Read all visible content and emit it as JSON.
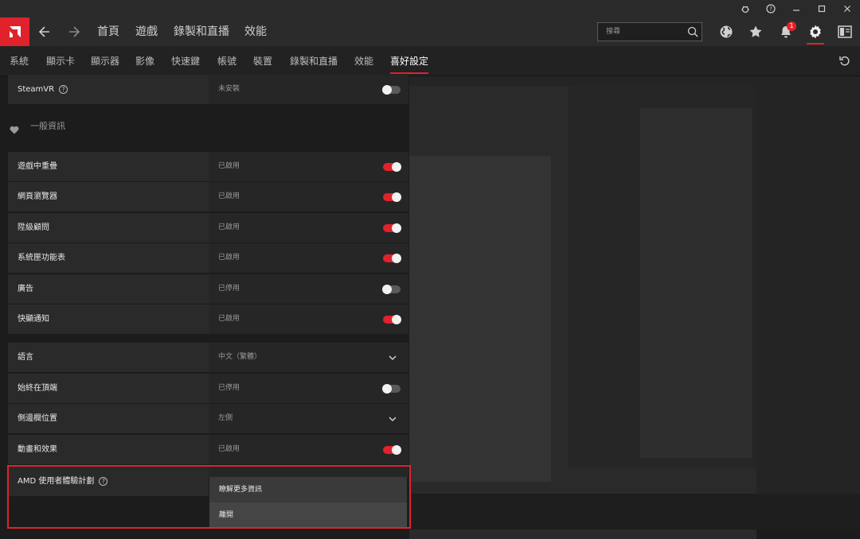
{
  "nav": {
    "home": "首頁",
    "gaming": "遊戲",
    "record_stream": "錄製和直播",
    "performance": "效能",
    "search_placeholder": "搜尋",
    "notification_count": "1"
  },
  "subtabs": [
    "系統",
    "顯示卡",
    "顯示器",
    "影像",
    "快速鍵",
    "帳號",
    "裝置",
    "錄製和直播",
    "效能",
    "喜好設定"
  ],
  "active_tab": "喜好設定",
  "steamvr": {
    "label": "SteamVR",
    "value": "未安裝",
    "enabled": false
  },
  "section_general": "一般資訊",
  "general": [
    {
      "label": "遊戲中重疊",
      "value": "已啟用",
      "enabled": true
    },
    {
      "label": "網頁瀏覽器",
      "value": "已啟用",
      "enabled": true
    },
    {
      "label": "陞級顧問",
      "value": "已啟用",
      "enabled": true
    },
    {
      "label": "系統匣功能表",
      "value": "已啟用",
      "enabled": true
    },
    {
      "label": "廣告",
      "value": "已停用",
      "enabled": false
    },
    {
      "label": "快顯通知",
      "value": "已啟用",
      "enabled": true
    }
  ],
  "language": {
    "label": "語言",
    "value": "中文（繁體）"
  },
  "always_on_top": {
    "label": "始終在頂端",
    "value": "已停用",
    "enabled": false
  },
  "sidebar_position": {
    "label": "側邊欄位置",
    "value": "左側"
  },
  "animation": {
    "label": "動畫和效果",
    "value": "已啟用",
    "enabled": true
  },
  "amd_program": {
    "label": "AMD 使用者體驗計劃"
  },
  "menu": {
    "learn_more": "瞭解更多資訊",
    "leave": "離開"
  },
  "colors": {
    "accent": "#e0222c",
    "bg": "#1c1c1c"
  }
}
